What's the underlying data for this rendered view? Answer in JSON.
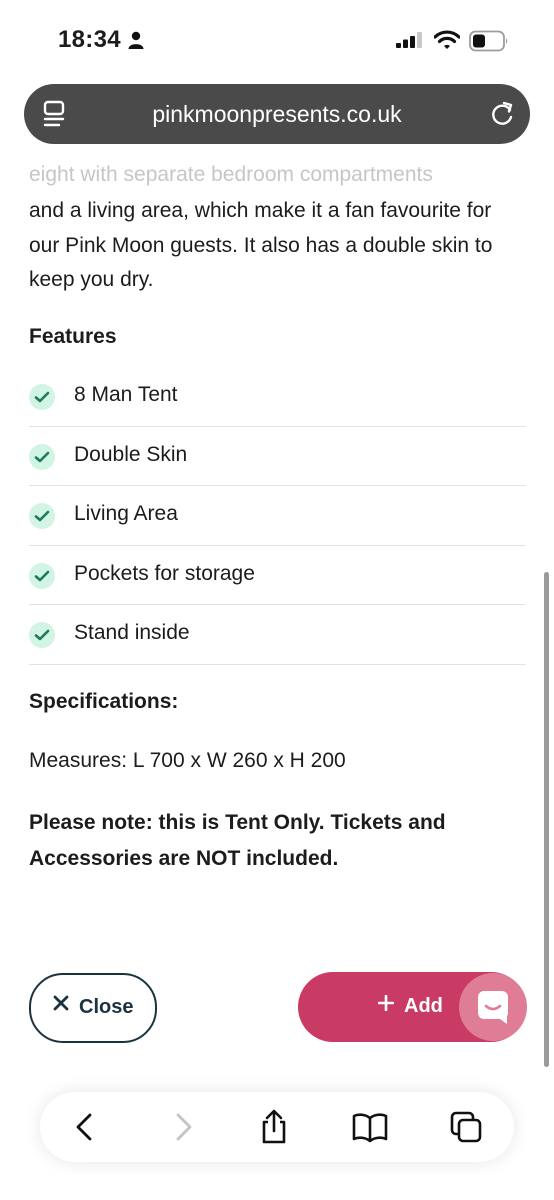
{
  "status_bar": {
    "time": "18:34"
  },
  "browser": {
    "url": "pinkmoonpresents.co.uk"
  },
  "content": {
    "faded_line": "eight with separate bedroom compartments",
    "description": "and a living area, which make it a fan favourite for our Pink Moon guests. It also has a double skin to keep you dry.",
    "features_heading": "Features",
    "features": [
      {
        "label": "8 Man Tent"
      },
      {
        "label": "Double Skin"
      },
      {
        "label": "Living Area"
      },
      {
        "label": "Pockets for storage"
      },
      {
        "label": "Stand inside"
      }
    ],
    "specifications_heading": "Specifications:",
    "measures": "Measures: L 700 x W 260 x H 200",
    "note": "Please note: this is Tent Only. Tickets and Accessories are NOT included."
  },
  "actions": {
    "close_label": "Close",
    "add_label": "Add"
  },
  "colors": {
    "add_button": "#c93a65",
    "chat_button": "#e07d96",
    "close_border": "#1b3340",
    "check_bg": "#d1f4e4",
    "check_mark": "#1f7a5a"
  },
  "icons": {
    "status": [
      "person-icon",
      "signal-icon",
      "wifi-icon",
      "battery-icon"
    ],
    "url_bar": [
      "reader-icon",
      "reload-icon"
    ],
    "toolbar": [
      "back-icon",
      "forward-icon",
      "share-icon",
      "bookmarks-icon",
      "tabs-icon"
    ]
  }
}
